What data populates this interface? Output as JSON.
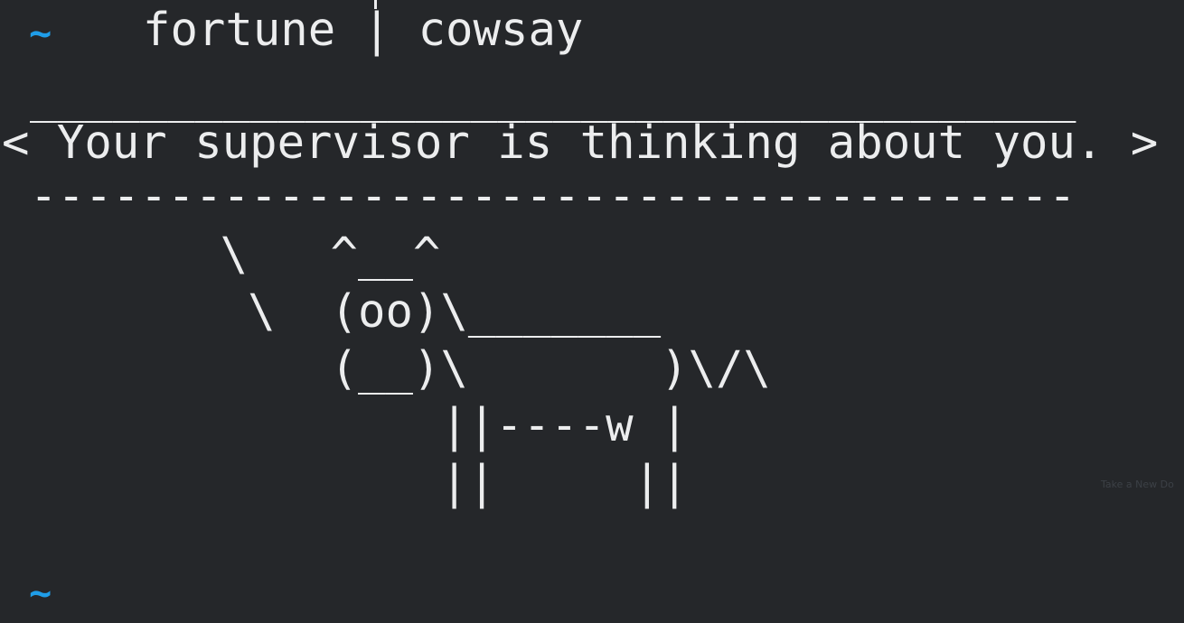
{
  "terminal": {
    "prompt_symbol": "~",
    "prompt_color": "#1f9de8",
    "background_color": "#25272a",
    "text_color": "#ecedee",
    "command": "fortune | cowsay",
    "output": {
      "bubble_top": "______________________________________",
      "message": "< Your supervisor is thinking about you. >",
      "bubble_bottom": "--------------------------------------",
      "cow": [
        "        \\   ^__^",
        "         \\  (oo)\\_______",
        "            (__)\\       )\\/\\",
        "                ||----w |",
        "                ||     ||"
      ]
    },
    "watermark": "Take a New Do"
  }
}
